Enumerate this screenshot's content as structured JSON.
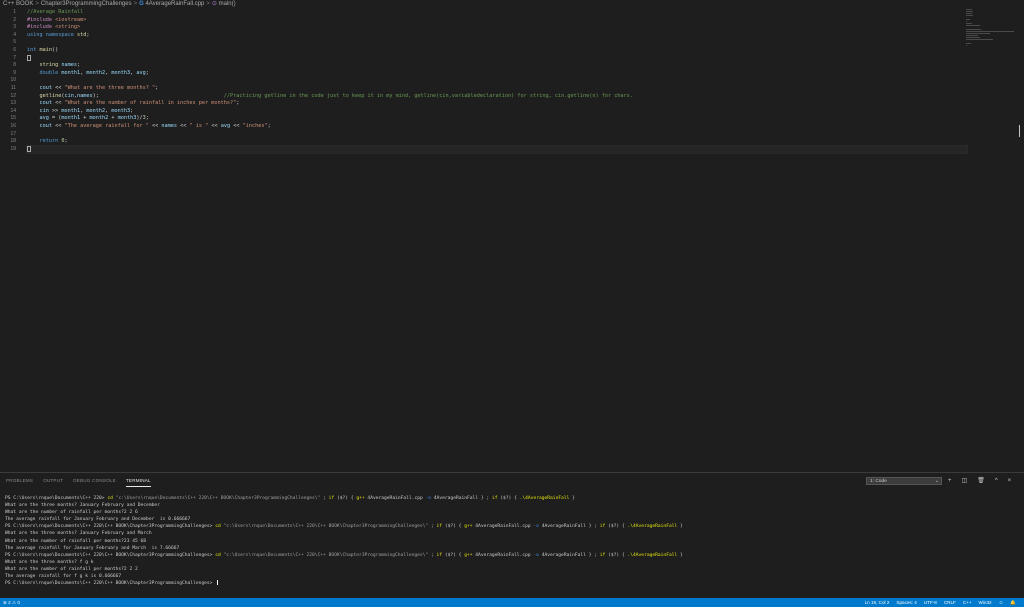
{
  "breadcrumb": {
    "items": [
      "C++ BOOK",
      "Chapter3ProgrammingChallenges",
      "4AverageRainFall.cpp",
      "main()"
    ],
    "separator": ">",
    "file_icon_glyph": "G",
    "function_icon_glyph": "⊙"
  },
  "editor": {
    "line_numbers": [
      "1",
      "2",
      "3",
      "4",
      "5",
      "6",
      "7",
      "8",
      "9",
      "10",
      "11",
      "12",
      "13",
      "14",
      "15",
      "16",
      "17",
      "18",
      "19"
    ],
    "code_lines": [
      "//Average Rainfall",
      "#include <iostream>",
      "#include <string>",
      "using namespace std;",
      "",
      "int main()",
      "{",
      "    string names;",
      "    double month1, month2, month3, avg;",
      "",
      "    cout << \"What are the three months? \";",
      "    getline(cin,names);                                        //Practicing getline in the code just to keep it in my mind, getline(cin,variabledeclaration) for string, cin.getline(n) for chars.",
      "    cout << \"What are the number of rainfall in inches per months?\";",
      "    cin >> month1, month2, month3;",
      "    avg = (month1 + month2 + month3)/3;",
      "    cout << \"The average rainfall for \" << names << \" is \" << avg << \"inches\";",
      "",
      "    return 0;",
      "}"
    ],
    "current_line": 19
  },
  "panel": {
    "tabs": [
      {
        "label": "PROBLEMS",
        "active": false
      },
      {
        "label": "OUTPUT",
        "active": false
      },
      {
        "label": "DEBUG CONSOLE",
        "active": false
      },
      {
        "label": "TERMINAL",
        "active": true
      }
    ],
    "terminal_selector": "1: Code",
    "actions": {
      "add": "+",
      "split": "◫",
      "kill": "🗑",
      "maximize": "^",
      "close": "×"
    },
    "terminal_lines": [
      "PS C:\\Users\\rnque\\Documents\\C++ 220> cd \"c:\\Users\\rnque\\Documents\\C++ 220\\C++ BOOK\\Chapter3ProgrammingChallenges\\\" ; if ($?) { g++ 4AverageRainFall.cpp -o 4AverageRainFall } ; if ($?) { .\\4AverageRainFall }",
      "What are the three months? January February and December",
      "What are the number of rainfall per months?2 2 6",
      "The average rainfall for January February and December  is 0.666667",
      "PS C:\\Users\\rnque\\Documents\\C++ 220\\C++ BOOK\\Chapter3ProgrammingChallenges> cd \"c:\\Users\\rnque\\Documents\\C++ 220\\C++ BOOK\\Chapter3ProgrammingChallenges\\\" ; if ($?) { g++ 4AverageRainFall.cpp -o 4AverageRainFall } ; if ($?) { .\\4AverageRainFall }",
      "What are the three months? January February and March",
      "What are the number of rainfall per months?23 45 68",
      "The average rainfall for January February and March  is 7.66667",
      "PS C:\\Users\\rnque\\Documents\\C++ 220\\C++ BOOK\\Chapter3ProgrammingChallenges> cd \"c:\\Users\\rnque\\Documents\\C++ 220\\C++ BOOK\\Chapter3ProgrammingChallenges\\\" ; if ($?) { g++ 4AverageRainFall.cpp -o 4AverageRainFall } ; if ($?) { .\\4AverageRainFall }",
      "What are the three months? f g k",
      "What are the number of rainfall per months?2 2 2",
      "The average rainfall for f g k is 0.666667",
      "PS C:\\Users\\rnque\\Documents\\C++ 220\\C++ BOOK\\Chapter3ProgrammingChallenges> "
    ]
  },
  "statusbar": {
    "left": "⊗ 2 ⚠ 0",
    "items": [
      "Ln 19, Col 2",
      "Spaces: 4",
      "UTF-8",
      "CRLF",
      "C++",
      "Win32"
    ],
    "feedback_icon": "☺",
    "bell_icon": "🔔"
  },
  "colors": {
    "background": "#1e1e1e",
    "statusbar": "#007acc",
    "comment": "#6a9955",
    "keyword": "#569cd6",
    "preprocessor": "#c586c0",
    "string": "#ce9178"
  }
}
